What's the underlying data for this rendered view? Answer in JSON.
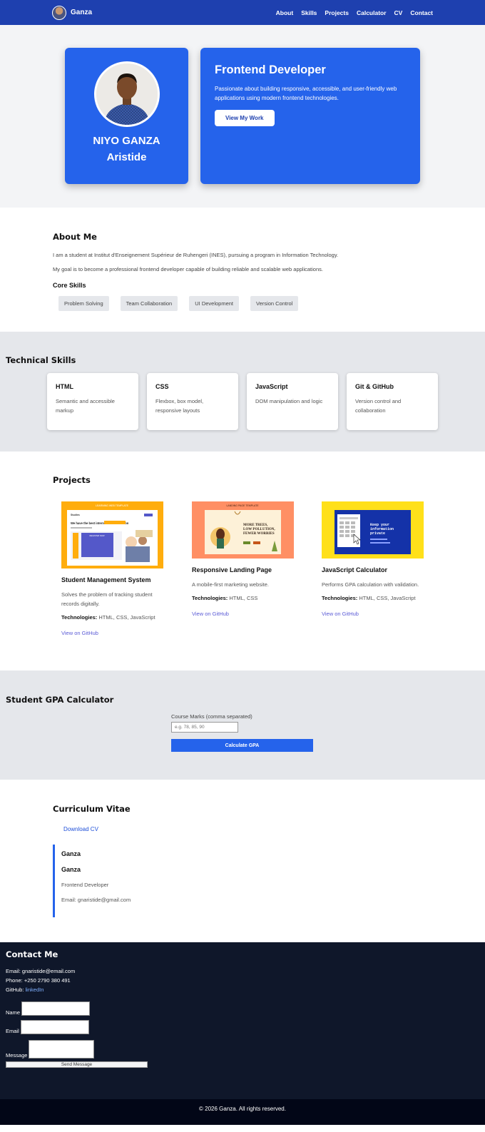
{
  "nav": {
    "brand": "Ganza",
    "links": [
      "About",
      "Skills",
      "Projects",
      "Calculator",
      "CV",
      "Contact"
    ]
  },
  "hero": {
    "name_line1": "NIYO GANZA",
    "name_line2": "Aristide",
    "title": "Frontend Developer",
    "text": "Passionate about building responsive, accessible, and user-friendly web applications using modern frontend technologies.",
    "button": "View My Work"
  },
  "about": {
    "title": "About Me",
    "p1": "I am a student at Institut d'Enseignement Supérieur de Ruhengeri (INES), pursuing a program in Information Technology.",
    "p2": "My goal is to become a professional frontend developer capable of building reliable and scalable web applications.",
    "core_title": "Core Skills",
    "chips": [
      "Problem Solving",
      "Team Collaboration",
      "UI Development",
      "Version Control"
    ]
  },
  "skills": {
    "title": "Technical Skills",
    "cards": [
      {
        "name": "HTML",
        "desc": "Semantic and accessible markup"
      },
      {
        "name": "CSS",
        "desc": "Flexbox, box model, responsive layouts"
      },
      {
        "name": "JavaScript",
        "desc": "DOM manipulation and logic"
      },
      {
        "name": "Git & GitHub",
        "desc": "Version control and collaboration"
      }
    ]
  },
  "projects": {
    "title": "Projects",
    "tech_label": "Technologies:",
    "items": [
      {
        "name": "Student Management System",
        "desc": "Solves the problem of tracking student records digitally.",
        "tech": " HTML, CSS, JavaScript",
        "link": "View on GitHub",
        "thumb_banner": "LEARNING WEB TEMPLATE",
        "thumb_head": "We have the best international education",
        "thumb_brand": "Studies",
        "thumb_cta": "REGISTER NOW"
      },
      {
        "name": "Responsive Landing Page",
        "desc": "A mobile-first marketing website.",
        "tech": " HTML, CSS",
        "link": "View on GitHub",
        "thumb_banner": "LANDING PAGE TEMPLATE",
        "thumb_head1": "MORE TREES,",
        "thumb_head2": "LOW POLLUTION,",
        "thumb_head3": "FEWER WORRIES"
      },
      {
        "name": "JavaScript Calculator",
        "desc": "Performs GPA calculation with validation.",
        "tech": " HTML, CSS, JavaScript",
        "link": "View on GitHub",
        "thumb_head1": "Keep your",
        "thumb_head2": "information",
        "thumb_head3": "private"
      }
    ]
  },
  "gpa": {
    "title": "Student GPA Calculator",
    "label": "Course Marks (comma separated)",
    "placeholder": "e.g. 78, 85, 90",
    "button": "Calculate GPA"
  },
  "cv": {
    "title": "Curriculum Vitae",
    "download": "Download CV",
    "name1": "Ganza",
    "name2": "Ganza",
    "role": "Frontend Developer",
    "email": "Email: gnaristide@gmail.com"
  },
  "contact": {
    "title": "Contact Me",
    "email": "Email: gnaristide@email.com",
    "phone": "Phone: +250 2790 380 491",
    "github_label": "GitHub: ",
    "github_link": "linkedIn",
    "name_label": "Name",
    "email_label": "Email",
    "message_label": "Message",
    "send": "Send Message"
  },
  "footer": "© 2026 Ganza. All rights reserved.",
  "colors": {
    "nav": "#1e40af",
    "card": "#2563eb",
    "footer": "#020617",
    "contact": "#0f172a"
  }
}
